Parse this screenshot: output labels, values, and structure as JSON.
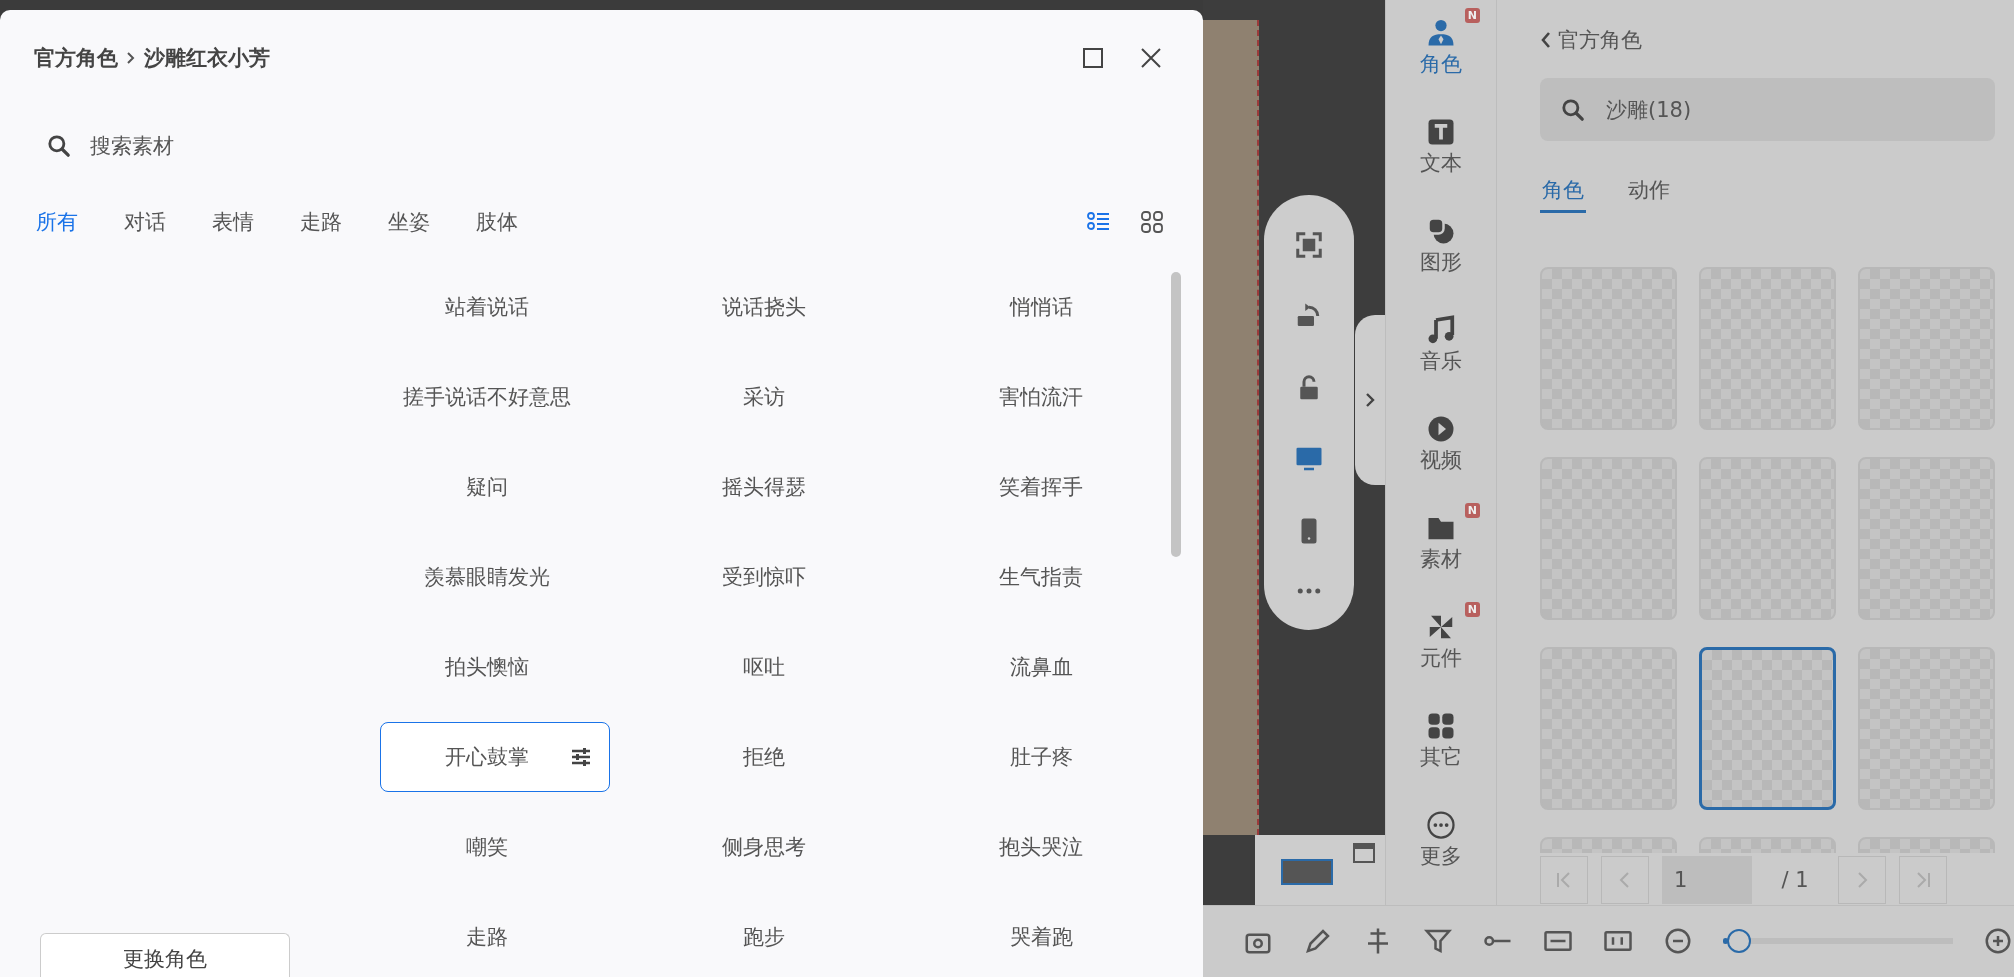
{
  "dialog": {
    "breadcrumb": [
      "官方角色",
      "沙雕红衣小芳"
    ],
    "search": {
      "placeholder": "搜索素材"
    },
    "tabs": [
      {
        "label": "所有",
        "selected": true
      },
      {
        "label": "对话",
        "selected": false
      },
      {
        "label": "表情",
        "selected": false
      },
      {
        "label": "走路",
        "selected": false
      },
      {
        "label": "坐姿",
        "selected": false
      },
      {
        "label": "肢体",
        "selected": false
      }
    ],
    "views": [
      {
        "kind": "list",
        "selected": true
      },
      {
        "kind": "grid",
        "selected": false
      }
    ],
    "actions": [
      {
        "label": "站着说话",
        "selected": false
      },
      {
        "label": "说话挠头",
        "selected": false
      },
      {
        "label": "悄悄话",
        "selected": false
      },
      {
        "label": "搓手说话不好意思",
        "selected": false
      },
      {
        "label": "采访",
        "selected": false
      },
      {
        "label": "害怕流汗",
        "selected": false
      },
      {
        "label": "疑问",
        "selected": false
      },
      {
        "label": "摇头得瑟",
        "selected": false
      },
      {
        "label": "笑着挥手",
        "selected": false
      },
      {
        "label": "羡慕眼睛发光",
        "selected": false
      },
      {
        "label": "受到惊吓",
        "selected": false
      },
      {
        "label": "生气指责",
        "selected": false
      },
      {
        "label": "拍头懊恼",
        "selected": false
      },
      {
        "label": "呕吐",
        "selected": false
      },
      {
        "label": "流鼻血",
        "selected": false
      },
      {
        "label": "开心鼓掌",
        "selected": true
      },
      {
        "label": "拒绝",
        "selected": false
      },
      {
        "label": "肚子疼",
        "selected": false
      },
      {
        "label": "嘲笑",
        "selected": false
      },
      {
        "label": "侧身思考",
        "selected": false
      },
      {
        "label": "抱头哭泣",
        "selected": false
      },
      {
        "label": "走路",
        "selected": false
      },
      {
        "label": "跑步",
        "selected": false
      },
      {
        "label": "哭着跑",
        "selected": false
      }
    ],
    "change_button": "更换角色"
  },
  "toolbar": [
    {
      "kind": "fit",
      "selected": false
    },
    {
      "kind": "rotate",
      "selected": false
    },
    {
      "kind": "unlock",
      "selected": false
    },
    {
      "kind": "desktop",
      "selected": true
    },
    {
      "kind": "phone",
      "selected": false
    },
    {
      "kind": "more",
      "selected": false
    }
  ],
  "nav": [
    {
      "kind": "person",
      "label": "角色",
      "selected": true,
      "badge": "N"
    },
    {
      "kind": "text",
      "label": "文本",
      "selected": false
    },
    {
      "kind": "shape",
      "label": "图形",
      "selected": false
    },
    {
      "kind": "music",
      "label": "音乐",
      "selected": false
    },
    {
      "kind": "video",
      "label": "视频",
      "selected": false
    },
    {
      "kind": "folder",
      "label": "素材",
      "selected": false,
      "badge": "N"
    },
    {
      "kind": "pinwheel",
      "label": "元件",
      "selected": false,
      "badge": "N"
    },
    {
      "kind": "apps",
      "label": "其它",
      "selected": false
    },
    {
      "kind": "more",
      "label": "更多",
      "selected": false
    }
  ],
  "panel": {
    "back": "官方角色",
    "search": {
      "value": "沙雕(18)"
    },
    "tabs": [
      {
        "label": "角色",
        "selected": true
      },
      {
        "label": "动作",
        "selected": false
      }
    ],
    "thumbnails": [
      {
        "selected": false
      },
      {
        "selected": false
      },
      {
        "selected": false
      },
      {
        "selected": false
      },
      {
        "selected": false
      },
      {
        "selected": false
      },
      {
        "selected": false
      },
      {
        "selected": true
      },
      {
        "selected": false
      },
      {
        "selected": false
      },
      {
        "selected": false
      },
      {
        "selected": false
      }
    ],
    "pager": {
      "page": "1",
      "total": "/ 1"
    }
  },
  "zoom": {
    "level": 0.02
  }
}
